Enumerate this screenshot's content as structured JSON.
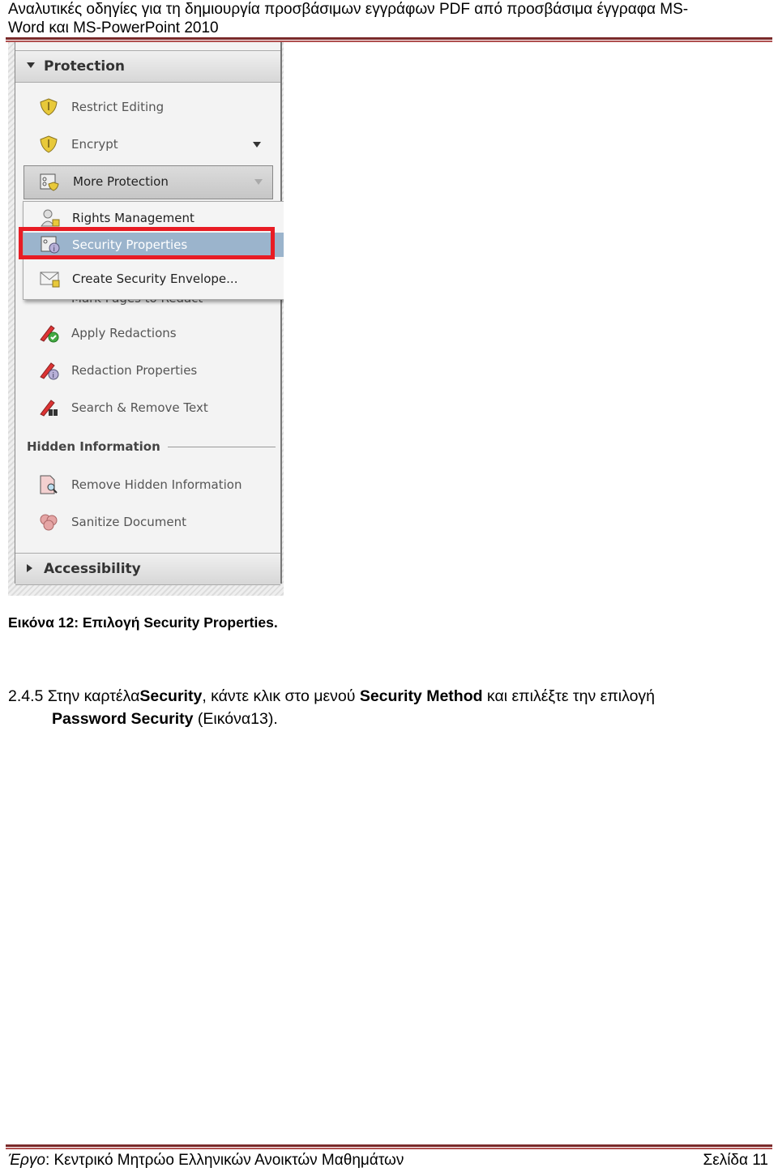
{
  "header": {
    "line1": "Αναλυτικές οδηγίες για τη δημιουργία προσβάσιμων εγγράφων PDF από προσβάσιμα έγγραφα MS-",
    "line2": "Word και MS-PowerPoint 2010"
  },
  "screenshot": {
    "protection_header": "Protection",
    "restrict_editing": "Restrict Editing",
    "encrypt": "Encrypt",
    "more_protection": "More Protection",
    "flyout": [
      "Rights Management",
      "Security Properties",
      "Create Security Envelope..."
    ],
    "mark_pages": "Mark Pages to Redact",
    "redaction_items": [
      "Apply Redactions",
      "Redaction Properties",
      "Search & Remove Text"
    ],
    "hidden_header": "Hidden Information",
    "hidden_items": [
      "Remove Hidden Information",
      "Sanitize Document"
    ],
    "accessibility_header": "Accessibility",
    "highlight_color": "#e81c24",
    "selected_color": "#9bb4cc"
  },
  "caption": "Εικόνα 12: Επιλογή Security Properties.",
  "step": {
    "number": "2.4.5",
    "t1": " Στην καρτέλα",
    "b1": "Security",
    "t2": ", κάντε κλικ στο μενού ",
    "b2": "Security Method",
    "t3": " και επιλέξτε την επιλογή",
    "b3": "Password Security",
    "t4": " (Εικόνα13)."
  },
  "footer": {
    "label": "Έργο",
    "text": ": Κεντρικό Μητρώο Ελληνικών Ανοικτών Μαθημάτων",
    "page": "Σελίδα 11"
  }
}
